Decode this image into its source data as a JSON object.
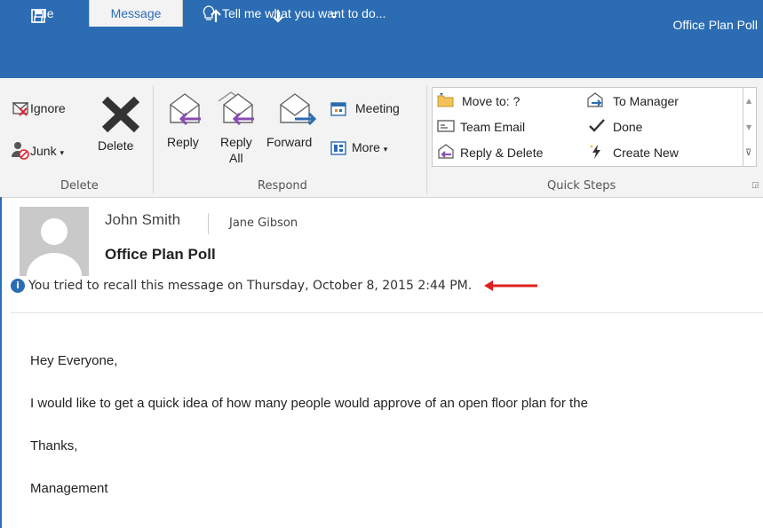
{
  "window": {
    "title": "Office Plan Poll"
  },
  "tabs": [
    {
      "label": "File"
    },
    {
      "label": "Message"
    },
    {
      "label": "Tell me what you want to do..."
    }
  ],
  "ribbon": {
    "delete_group": {
      "label": "Delete",
      "ignore": "Ignore",
      "junk": "Junk",
      "delete": "Delete"
    },
    "respond_group": {
      "label": "Respond",
      "reply": "Reply",
      "reply_all_1": "Reply",
      "reply_all_2": "All",
      "forward": "Forward",
      "meeting": "Meeting",
      "more": "More"
    },
    "quick_steps": {
      "label": "Quick Steps",
      "items": [
        "Move to: ?",
        "Team Email",
        "Reply & Delete",
        "To Manager",
        "Done",
        "Create New"
      ]
    }
  },
  "message": {
    "sender": "John Smith",
    "recipient": "Jane Gibson",
    "subject": "Office Plan Poll",
    "info": "You tried to recall this message on Thursday, October 8, 2015 2:44 PM.",
    "body": [
      "Hey Everyone,",
      "I would like to get a quick idea of how many people would approve of an open floor plan for the",
      "Thanks,",
      "Management"
    ]
  },
  "colors": {
    "accent": "#2b6cb3",
    "arrow": "#e02020",
    "reply_arrow": "#8a4bb3",
    "forward_arrow": "#2b6cb3"
  }
}
